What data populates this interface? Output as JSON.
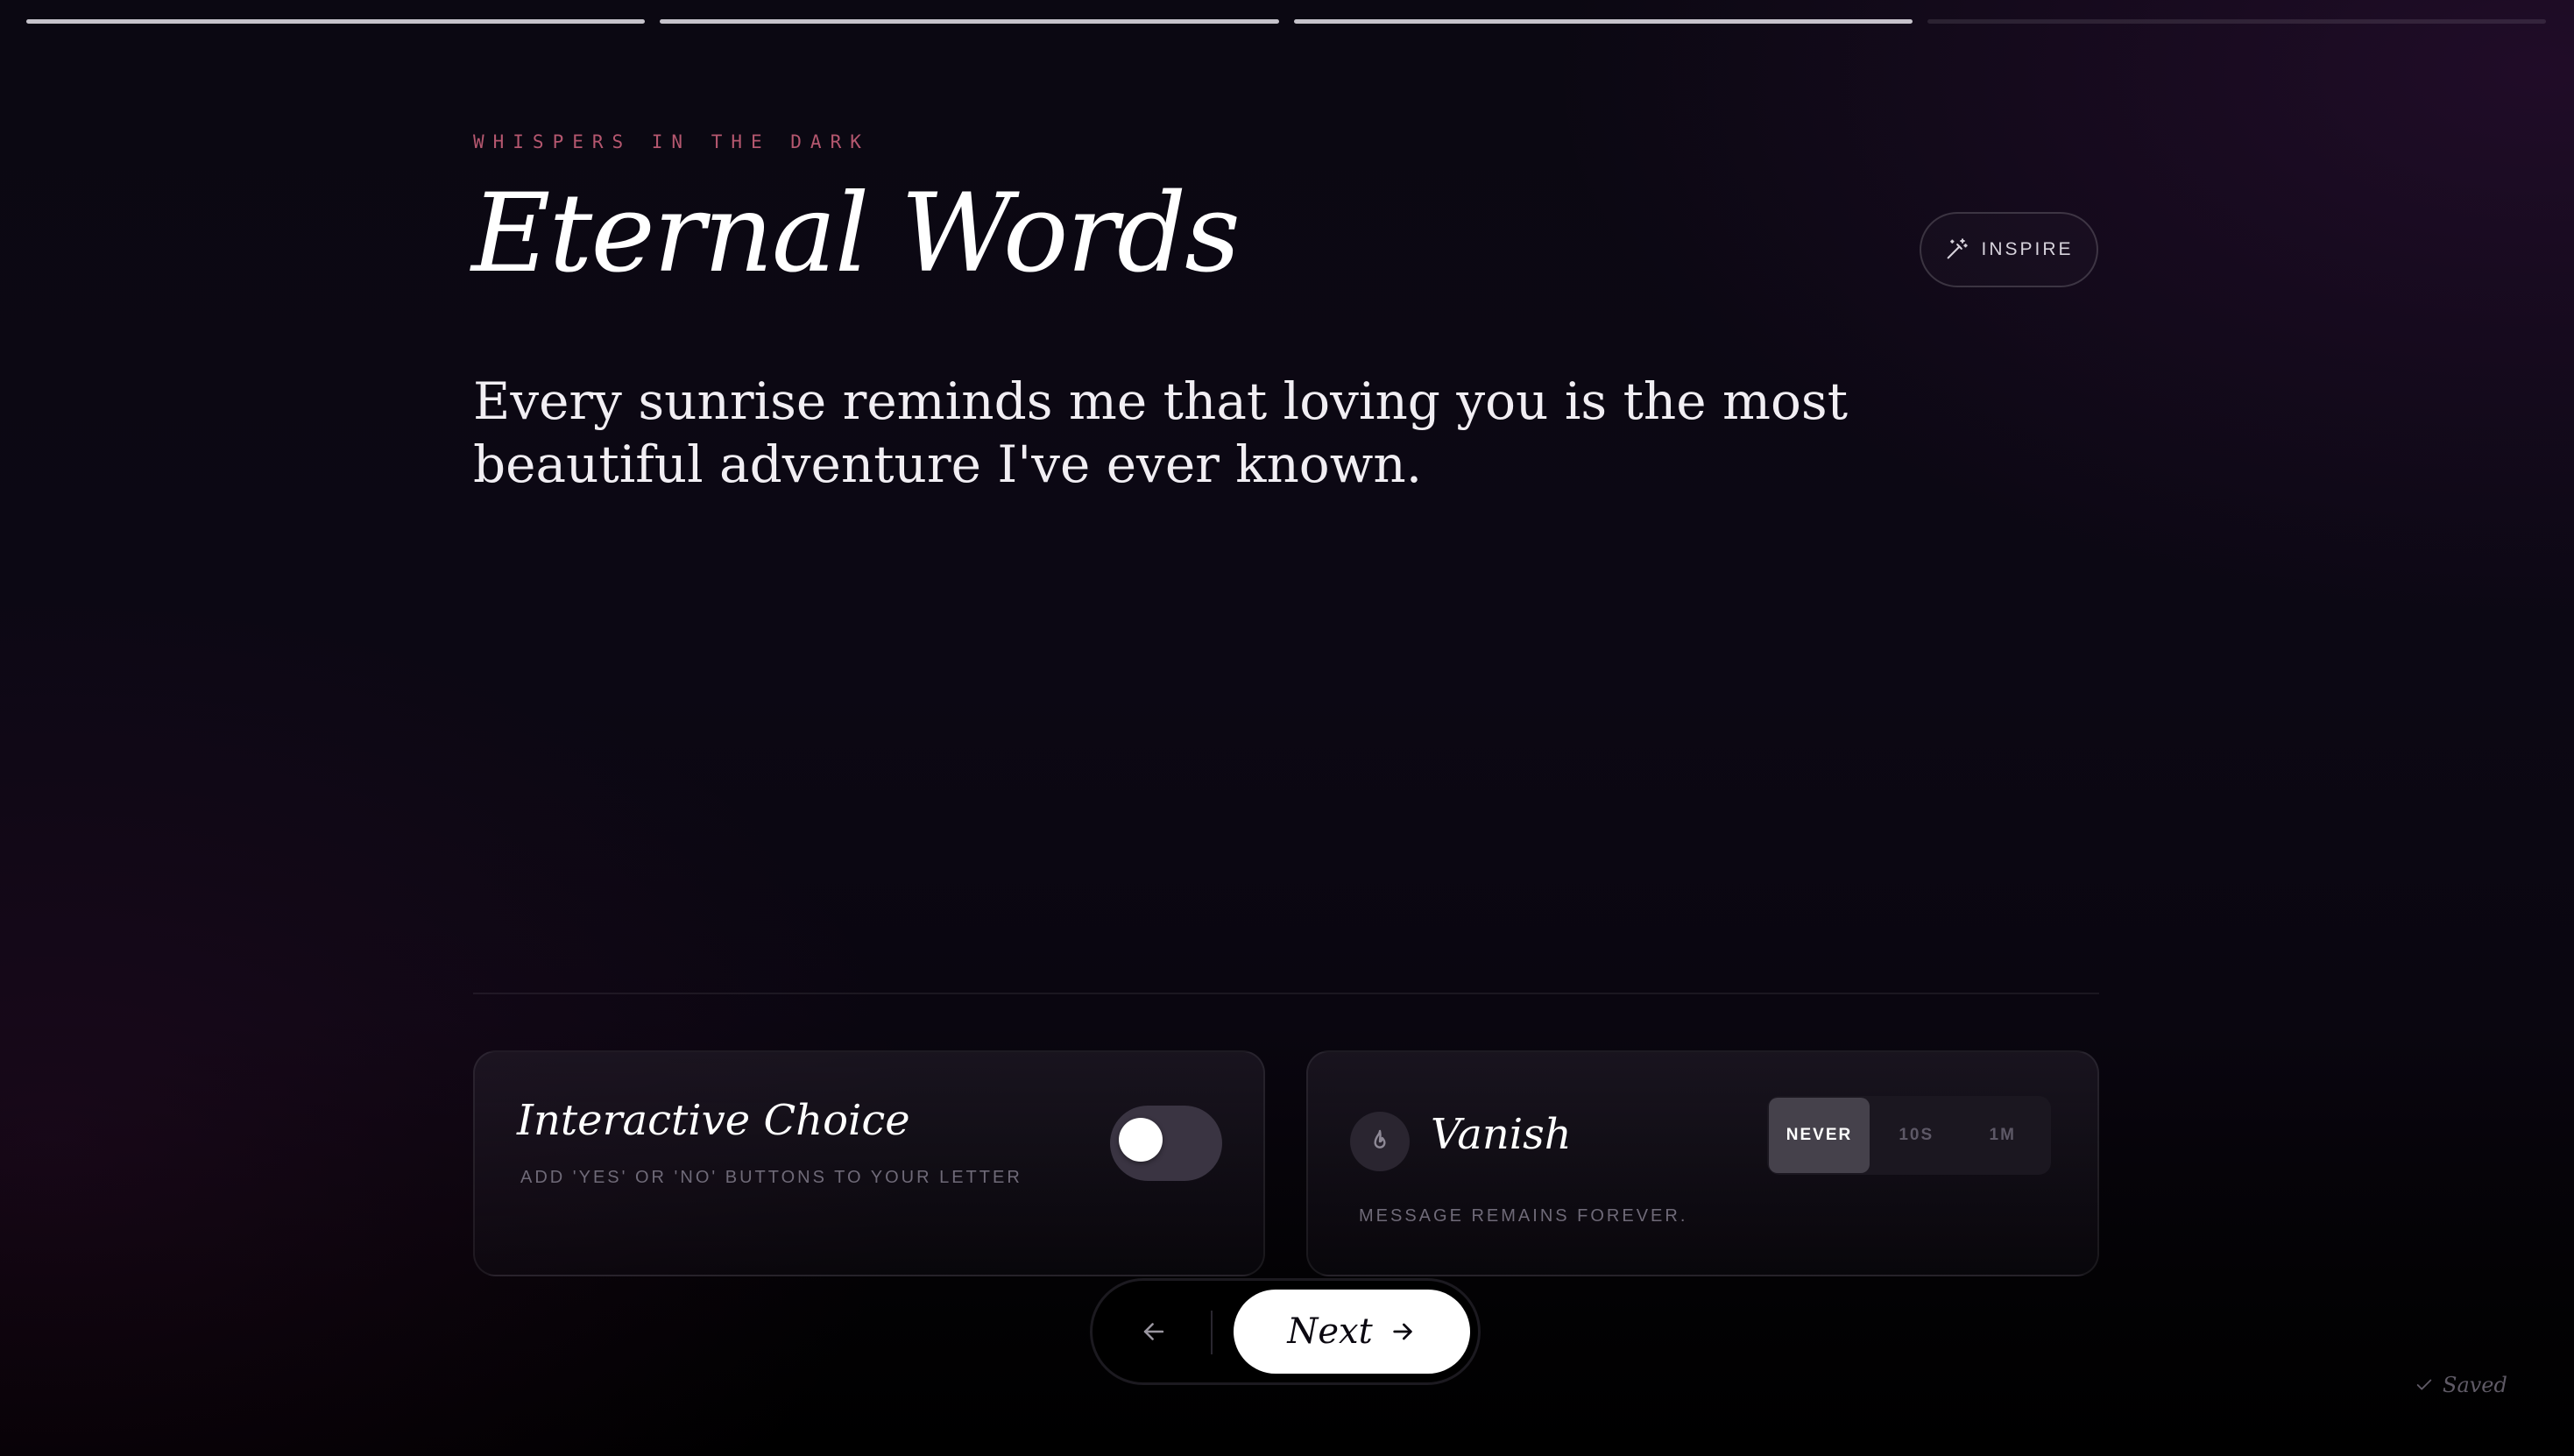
{
  "progress": {
    "total_steps": 4,
    "completed_steps": 3
  },
  "header": {
    "eyebrow": "WHISPERS IN THE DARK",
    "title": "Eternal Words",
    "inspire_label": "INSPIRE"
  },
  "message": {
    "text": "Every sunrise reminds me that loving you is the most beautiful adventure I've ever known."
  },
  "options": {
    "interactive_choice": {
      "title": "Interactive Choice",
      "subtitle": "ADD 'YES' OR 'NO' BUTTONS TO YOUR LETTER",
      "enabled": false
    },
    "vanish": {
      "title": "Vanish",
      "subtitle": "MESSAGE REMAINS FOREVER.",
      "options": [
        "NEVER",
        "10S",
        "1M"
      ],
      "selected": "NEVER"
    }
  },
  "nav": {
    "next_label": "Next"
  },
  "footer": {
    "saved_label": "Saved"
  },
  "colors": {
    "accent": "#b5576f",
    "background": "#0b0812",
    "toggle_track": "#3a3442",
    "segment_active": "#45414b"
  }
}
